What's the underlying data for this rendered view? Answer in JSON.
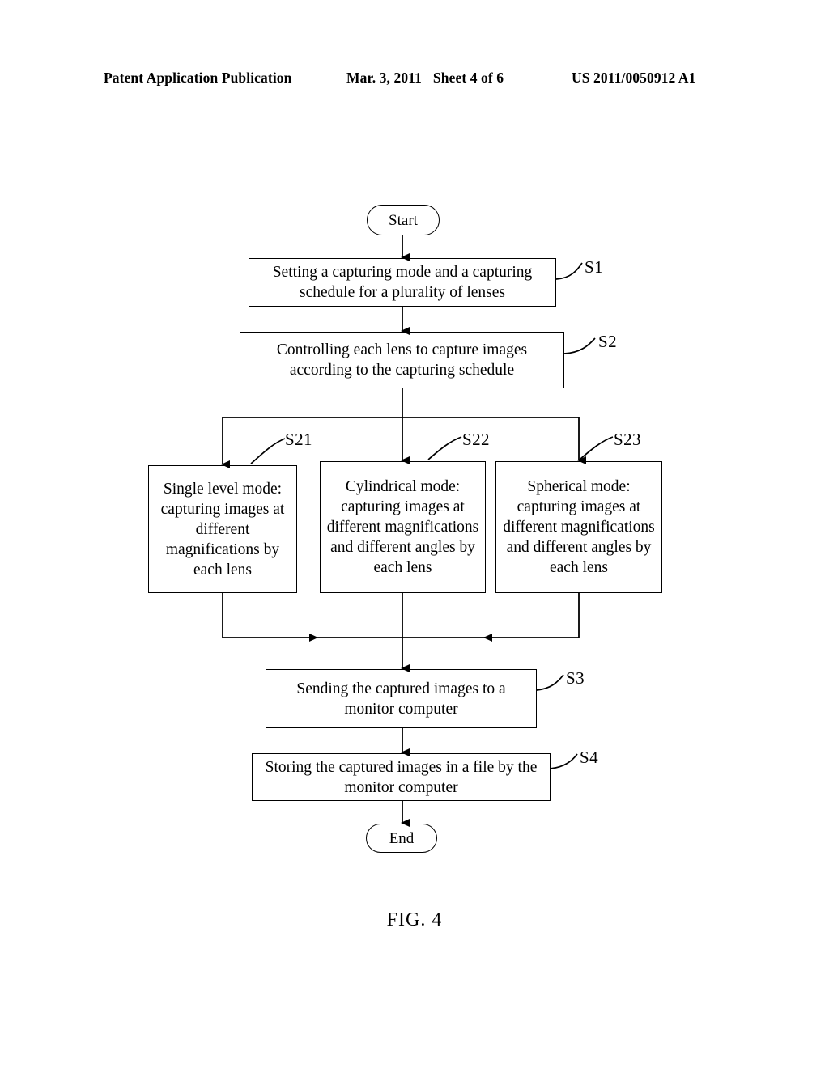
{
  "header": {
    "publication_label": "Patent Application Publication",
    "date": "Mar. 3, 2011",
    "sheet": "Sheet 4 of 6",
    "publication_number": "US 2011/0050912 A1"
  },
  "figure": {
    "caption": "FIG. 4",
    "nodes": {
      "start": {
        "label": "Start",
        "shape": "terminal"
      },
      "s1": {
        "label": "Setting a capturing mode and a capturing schedule for a plurality of lenses",
        "ref": "S1",
        "shape": "process"
      },
      "s2": {
        "label": "Controlling each lens to capture images according to the capturing schedule",
        "ref": "S2",
        "shape": "process"
      },
      "s21": {
        "label": "Single level mode: capturing images at different magnifications by each lens",
        "ref": "S21",
        "shape": "process"
      },
      "s22": {
        "label": "Cylindrical mode: capturing images at different magnifications and different angles by each lens",
        "ref": "S22",
        "shape": "process"
      },
      "s23": {
        "label": "Spherical mode: capturing images at different magnifications and different angles by each lens",
        "ref": "S23",
        "shape": "process"
      },
      "s3": {
        "label": "Sending the captured images to a monitor computer",
        "ref": "S3",
        "shape": "process"
      },
      "s4": {
        "label": "Storing the captured images in a file by the monitor computer",
        "ref": "S4",
        "shape": "process"
      },
      "end": {
        "label": "End",
        "shape": "terminal"
      }
    },
    "colors": {
      "ink": "#000000",
      "paper": "#ffffff"
    }
  }
}
